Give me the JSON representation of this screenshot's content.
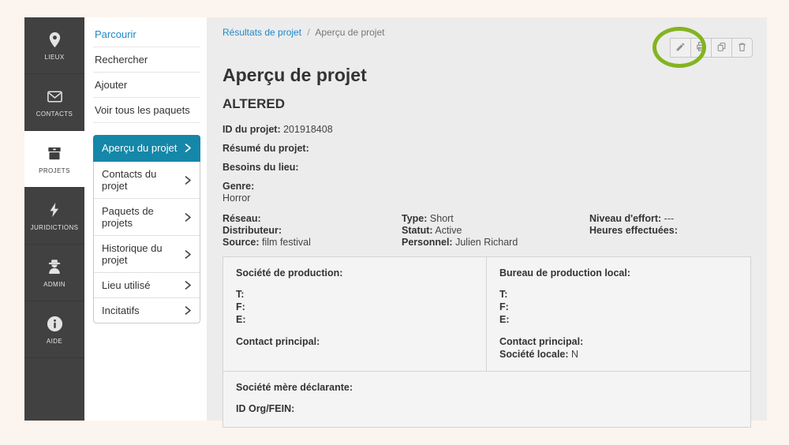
{
  "colors": {
    "accent_teal": "#1587a8",
    "link_blue": "#1f88c9",
    "annotation_green": "#84b421",
    "sidebar_bg": "#414141",
    "content_bg": "#ececec",
    "page_bg": "#fcf4ef"
  },
  "sidebar": {
    "items": [
      {
        "label": "LIEUX",
        "icon": "map-pin-icon",
        "active": false
      },
      {
        "label": "CONTACTS",
        "icon": "envelope-icon",
        "active": false
      },
      {
        "label": "PROJETS",
        "icon": "archive-box-icon",
        "active": true
      },
      {
        "label": "JURIDICTIONS",
        "icon": "lightning-icon",
        "active": false
      },
      {
        "label": "ADMIN",
        "icon": "spy-icon",
        "active": false
      },
      {
        "label": "AIDE",
        "icon": "info-icon",
        "active": false
      }
    ]
  },
  "menu": {
    "items": [
      {
        "label": "Parcourir",
        "active": true
      },
      {
        "label": "Rechercher",
        "active": false
      },
      {
        "label": "Ajouter",
        "active": false
      },
      {
        "label": "Voir tous les paquets",
        "active": false
      }
    ]
  },
  "project_nav": {
    "items": [
      {
        "label": "Aperçu du projet",
        "active": true
      },
      {
        "label": "Contacts du projet",
        "active": false
      },
      {
        "label": "Paquets de projets",
        "active": false
      },
      {
        "label": "Historique du projet",
        "active": false
      },
      {
        "label": "Lieu utilisé",
        "active": false
      },
      {
        "label": "Incitatifs",
        "active": false
      }
    ]
  },
  "breadcrumb": {
    "link": "Résultats de projet",
    "separator": "/",
    "current": "Aperçu de projet"
  },
  "toolbar": {
    "buttons": [
      {
        "name": "edit"
      },
      {
        "name": "print"
      },
      {
        "name": "copy"
      },
      {
        "name": "delete"
      }
    ],
    "annotation": "green-circle-on-edit"
  },
  "content": {
    "title": "Aperçu de projet",
    "project_name": "ALTERED",
    "fields": {
      "id_label": "ID du projet:",
      "id_value": "201918408",
      "resume_label": "Résumé du projet:",
      "resume_value": "",
      "besoins_label": "Besoins du lieu:",
      "besoins_value": "",
      "genre_label": "Genre:",
      "genre_value": "Horror"
    },
    "columns": {
      "col1": [
        {
          "label": "Réseau:",
          "value": ""
        },
        {
          "label": "Distributeur:",
          "value": ""
        },
        {
          "label": "Source:",
          "value": "film festival"
        }
      ],
      "col2": [
        {
          "label": "Type:",
          "value": "Short"
        },
        {
          "label": "Statut:",
          "value": "Active"
        },
        {
          "label": "Personnel:",
          "value": "Julien Richard"
        }
      ],
      "col3": [
        {
          "label": "Niveau d'effort:",
          "value": "---"
        },
        {
          "label": "Heures effectuées:",
          "value": ""
        }
      ]
    },
    "production_box": {
      "title": "Société de production:",
      "t_label": "T:",
      "f_label": "F:",
      "e_label": "E:",
      "contact_label": "Contact principal:"
    },
    "local_office_box": {
      "title": "Bureau de production local:",
      "t_label": "T:",
      "f_label": "F:",
      "e_label": "E:",
      "contact_label": "Contact principal:",
      "company_label": "Société locale:",
      "company_value": "N"
    },
    "parent_box": {
      "title": "Société mère déclarante:",
      "org_label": "ID Org/FEIN:"
    }
  }
}
